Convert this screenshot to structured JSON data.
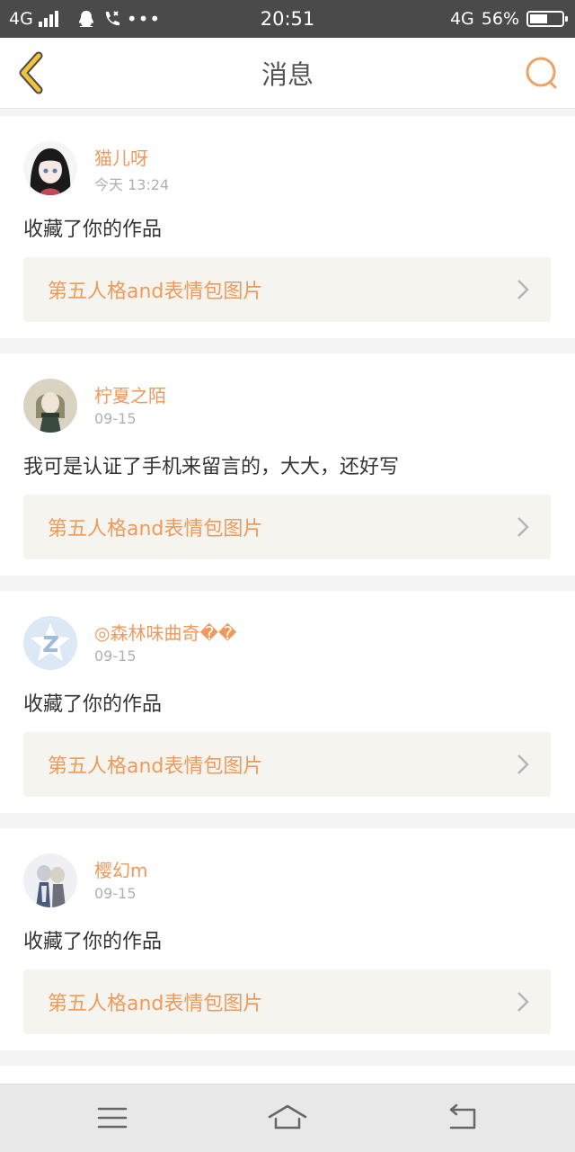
{
  "status_bar": {
    "network_left": "4G",
    "time": "20:51",
    "network_right": "4G",
    "battery": "56%",
    "battery_level": 0.56,
    "icons": [
      "signal-icon",
      "qq-icon",
      "phone-icon",
      "more-icon",
      "battery-icon"
    ]
  },
  "header": {
    "title": "消息",
    "back_icon": "chevron-left-icon",
    "search_icon": "search-icon",
    "accent": "#f3c33a",
    "search_color": "#f0a264"
  },
  "notifications": [
    {
      "user": "猫儿呀",
      "time": "今天 13:24",
      "message": "收藏了你的作品",
      "work_title": "第五人格and表情包图片"
    },
    {
      "user": "柠夏之陌",
      "time": "09-15",
      "message": "我可是认证了手机来留言的，大大，还好写",
      "work_title": "第五人格and表情包图片"
    },
    {
      "user": "◎森林味曲奇��",
      "time": "09-15",
      "message": "收藏了你的作品",
      "work_title": "第五人格and表情包图片"
    },
    {
      "user": "樱幻m",
      "time": "09-15",
      "message": "收藏了你的作品",
      "work_title": "第五人格and表情包图片"
    }
  ],
  "colors": {
    "username": "#ef9a5c",
    "link_bg": "#f5f4ef",
    "timestamp": "#b0b0b0"
  },
  "nav_bar": {
    "icons": [
      "menu-icon",
      "home-icon",
      "back-icon"
    ]
  }
}
